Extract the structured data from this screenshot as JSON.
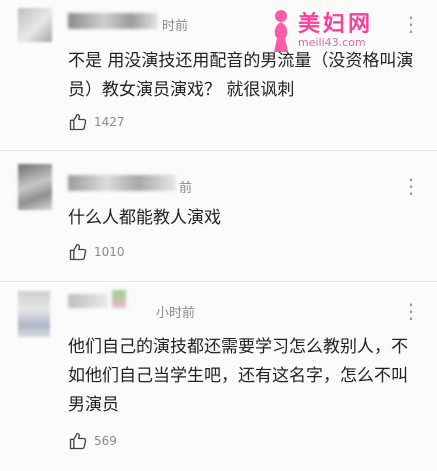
{
  "watermark": {
    "title": "美妇网",
    "url": "meili43.com"
  },
  "icons": {
    "more": "more-dots-icon",
    "like": "thumb-up-icon",
    "logo": "lady-silhouette-icon"
  },
  "comments": [
    {
      "time": "时前",
      "text": "不是 用没演技还用配音的男流量（没资格叫演员）教女演员演戏？ 就很讽刺",
      "likes": "1427",
      "more": "⋮"
    },
    {
      "time": "前",
      "text": "什么人都能教人演戏",
      "likes": "1010",
      "more": "⋮"
    },
    {
      "time": "小时前",
      "text": "他们自己的演技都还需要学习怎么教别人，不如他们自己当学生吧，还有这名字，怎么不叫男演员",
      "likes": "569",
      "more": "⋮"
    }
  ]
}
